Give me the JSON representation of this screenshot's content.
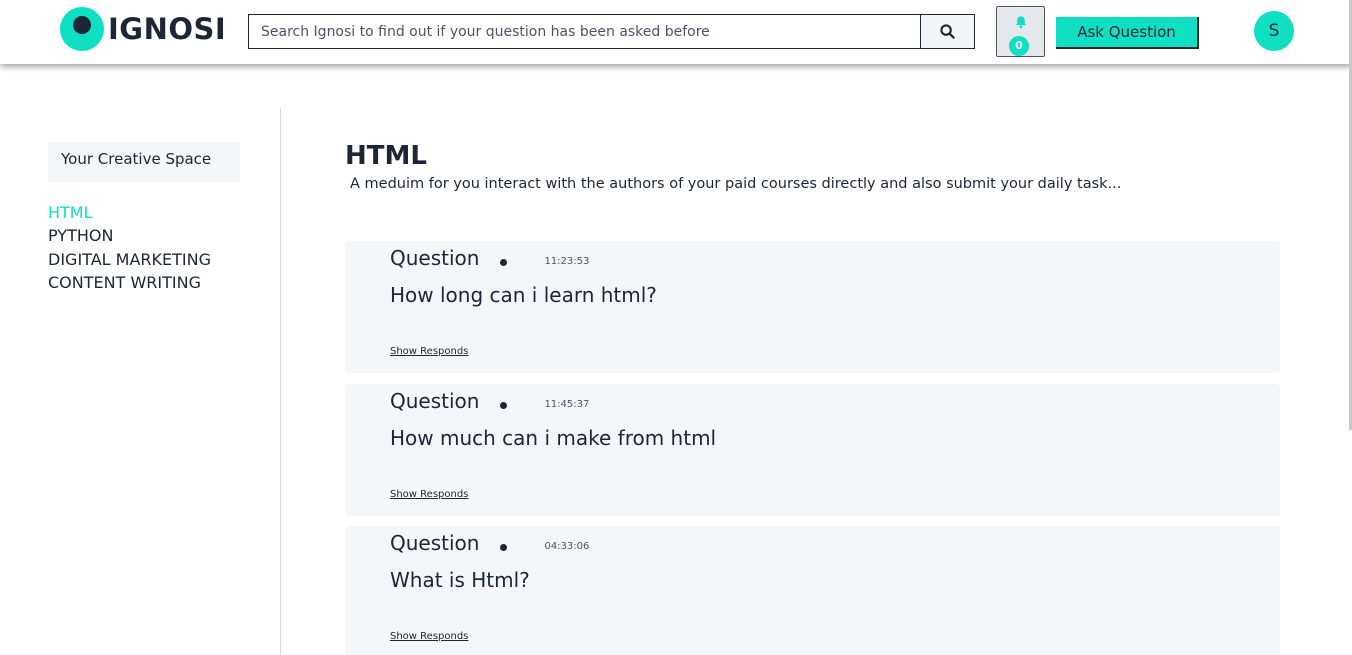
{
  "header": {
    "logo_text": "IGNOSI",
    "search_placeholder": "Search Ignosi to find out if your question has been asked before",
    "notification_count": "0",
    "ask_button": "Ask Question",
    "avatar_initial": "S"
  },
  "sidebar": {
    "space_title": "Your Creative Space",
    "categories": [
      "HTML",
      "PYTHON",
      "DIGITAL MARKETING",
      "CONTENT WRITING"
    ],
    "active_category": "HTML"
  },
  "main": {
    "title": "HTML",
    "subtitle": "A meduim for you interact with the authors of your paid courses directly and also submit your daily task...",
    "questions": [
      {
        "label": "Question",
        "time": "11:23:53",
        "text": "How long can i learn html?",
        "link": "Show Responds"
      },
      {
        "label": "Question",
        "time": "11:45:37",
        "text": "How much can i make from html",
        "link": "Show Responds"
      },
      {
        "label": "Question",
        "time": "04:33:06",
        "text": "What is Html?",
        "link": "Show Responds"
      }
    ]
  },
  "colors": {
    "accent": "#0fdfc2",
    "dark": "#1c2637",
    "card_bg": "#f4f7f9"
  },
  "icons": {
    "search": "search-icon",
    "bell": "bell-icon"
  }
}
